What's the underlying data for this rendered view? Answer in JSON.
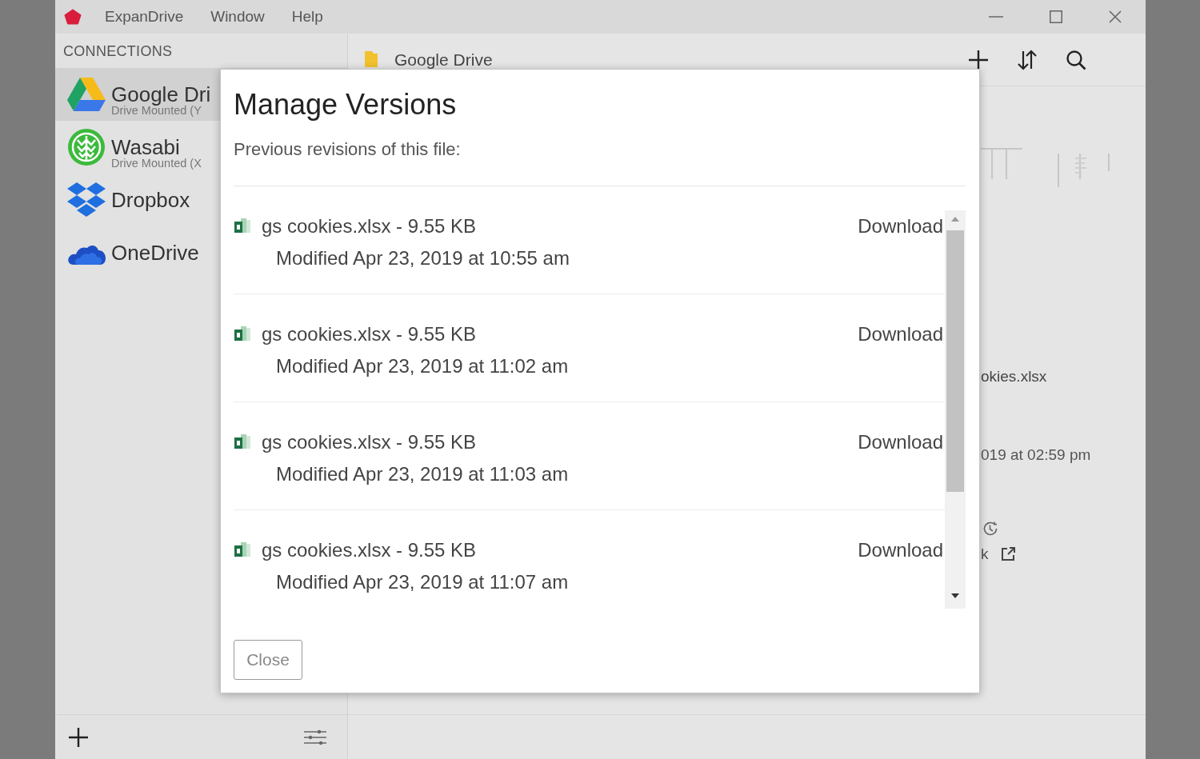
{
  "menu_bar": {
    "items": [
      "ExpanDrive",
      "Window",
      "Help"
    ]
  },
  "sidebar": {
    "header": "CONNECTIONS",
    "items": [
      {
        "name": "Google Dri",
        "status": "Drive Mounted (Y",
        "selected": true
      },
      {
        "name": "Wasabi",
        "status": "Drive Mounted (X",
        "selected": false
      },
      {
        "name": "Dropbox",
        "selected": false
      },
      {
        "name": "OneDrive",
        "selected": false
      }
    ]
  },
  "toolbar": {
    "title": "Google Drive"
  },
  "details": {
    "file_name": "okies.xlsx",
    "modified": "019 at 02:59 pm",
    "link": "k"
  },
  "dialog": {
    "title": "Manage Versions",
    "subtitle": "Previous revisions of this file:",
    "versions": [
      {
        "name": "gs cookies.xlsx - 9.55 KB",
        "modified": "Modified Apr 23, 2019 at 10:55 am",
        "action": "Download"
      },
      {
        "name": "gs cookies.xlsx - 9.55 KB",
        "modified": "Modified Apr 23, 2019 at 11:02 am",
        "action": "Download"
      },
      {
        "name": "gs cookies.xlsx - 9.55 KB",
        "modified": "Modified Apr 23, 2019 at 11:03 am",
        "action": "Download"
      },
      {
        "name": "gs cookies.xlsx - 9.55 KB",
        "modified": "Modified Apr 23, 2019 at 11:07 am",
        "action": "Download"
      }
    ],
    "close_button": "Close"
  }
}
